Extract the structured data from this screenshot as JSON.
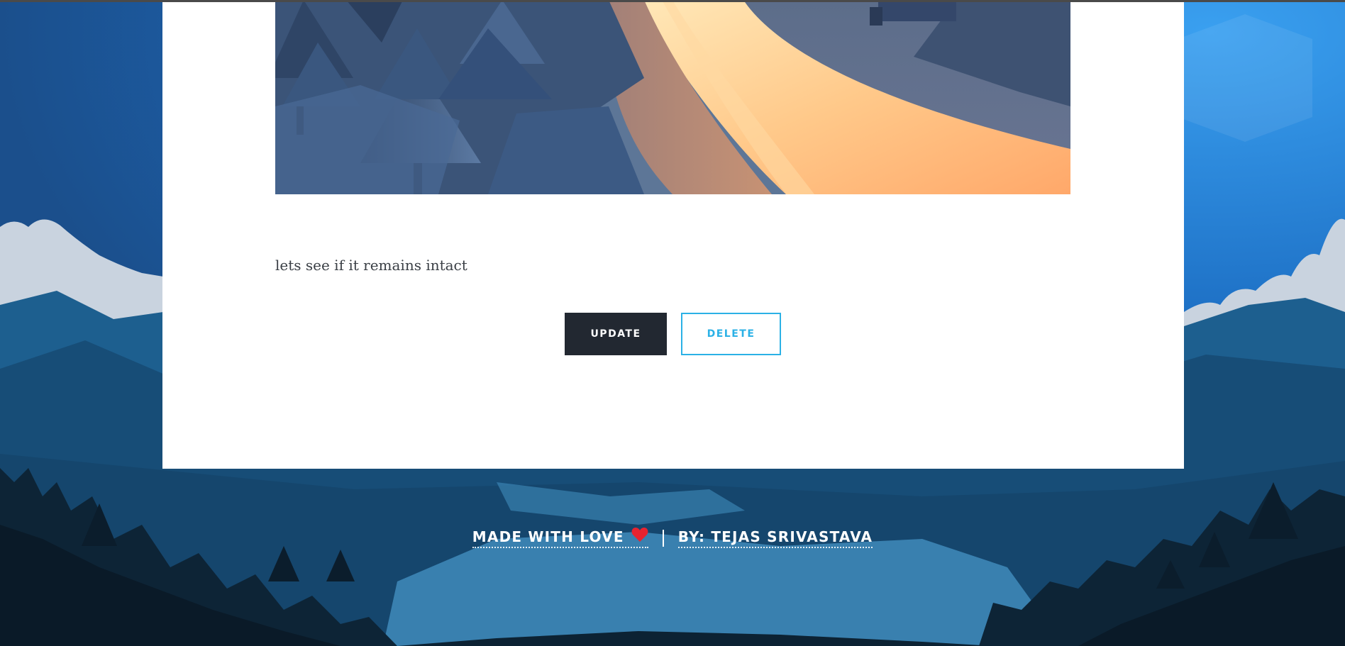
{
  "post": {
    "body": "lets see if it remains intact"
  },
  "actions": {
    "update_label": "UPDATE",
    "delete_label": "DELETE"
  },
  "footer": {
    "made_with": "MADE WITH LOVE",
    "author": "BY: TEJAS SRIVASTAVA"
  },
  "icons": {
    "heart": "heart-icon"
  },
  "colors": {
    "primary_button": "#222831",
    "accent": "#2bb1e6",
    "heart": "#e8232f",
    "card": "#ffffff"
  }
}
